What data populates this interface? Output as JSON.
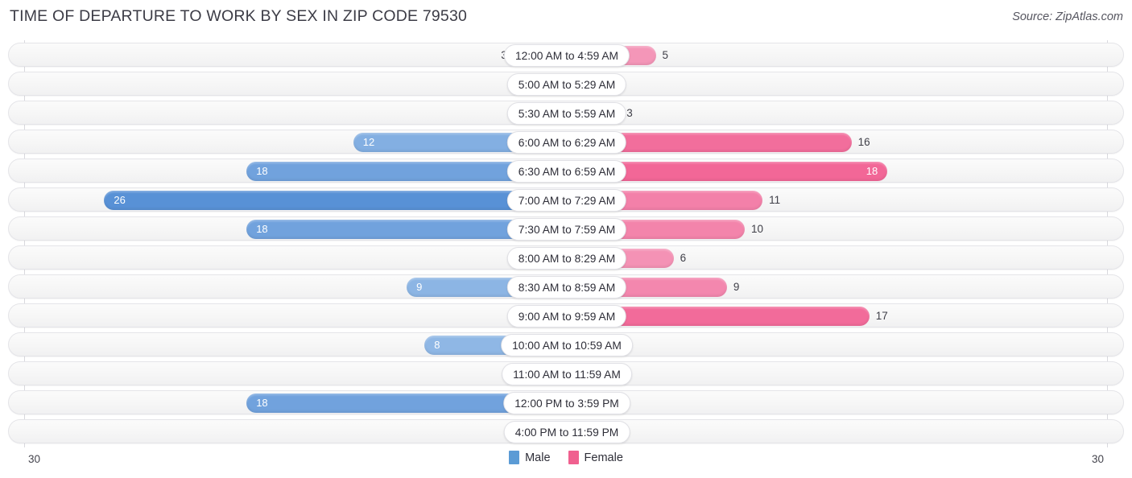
{
  "header": {
    "title": "TIME OF DEPARTURE TO WORK BY SEX IN ZIP CODE 79530",
    "source": "Source: ZipAtlas.com"
  },
  "legend": {
    "male_label": "Male",
    "female_label": "Female",
    "male_color": "#5B9BD5",
    "female_color": "#F0608F"
  },
  "axis": {
    "left_label": "30",
    "right_label": "30",
    "max": 30
  },
  "chart_data": {
    "type": "bar",
    "title": "TIME OF DEPARTURE TO WORK BY SEX IN ZIP CODE 79530",
    "subtitle": "",
    "xlabel": "",
    "ylabel": "",
    "orientation": "horizontal-diverging",
    "xlim": [
      30,
      30
    ],
    "grid": true,
    "legend_position": "bottom-center",
    "categories": [
      "12:00 AM to 4:59 AM",
      "5:00 AM to 5:29 AM",
      "5:30 AM to 5:59 AM",
      "6:00 AM to 6:29 AM",
      "6:30 AM to 6:59 AM",
      "7:00 AM to 7:29 AM",
      "7:30 AM to 7:59 AM",
      "8:00 AM to 8:29 AM",
      "8:30 AM to 8:59 AM",
      "9:00 AM to 9:59 AM",
      "10:00 AM to 10:59 AM",
      "11:00 AM to 11:59 AM",
      "12:00 PM to 3:59 PM",
      "4:00 PM to 11:59 PM"
    ],
    "series": [
      {
        "name": "Male",
        "side": "left",
        "values": [
          3,
          0,
          1,
          12,
          18,
          26,
          18,
          2,
          9,
          0,
          8,
          0,
          18,
          0
        ]
      },
      {
        "name": "Female",
        "side": "right",
        "values": [
          5,
          0,
          3,
          16,
          18,
          11,
          10,
          6,
          9,
          17,
          3,
          0,
          0,
          0
        ]
      }
    ]
  }
}
